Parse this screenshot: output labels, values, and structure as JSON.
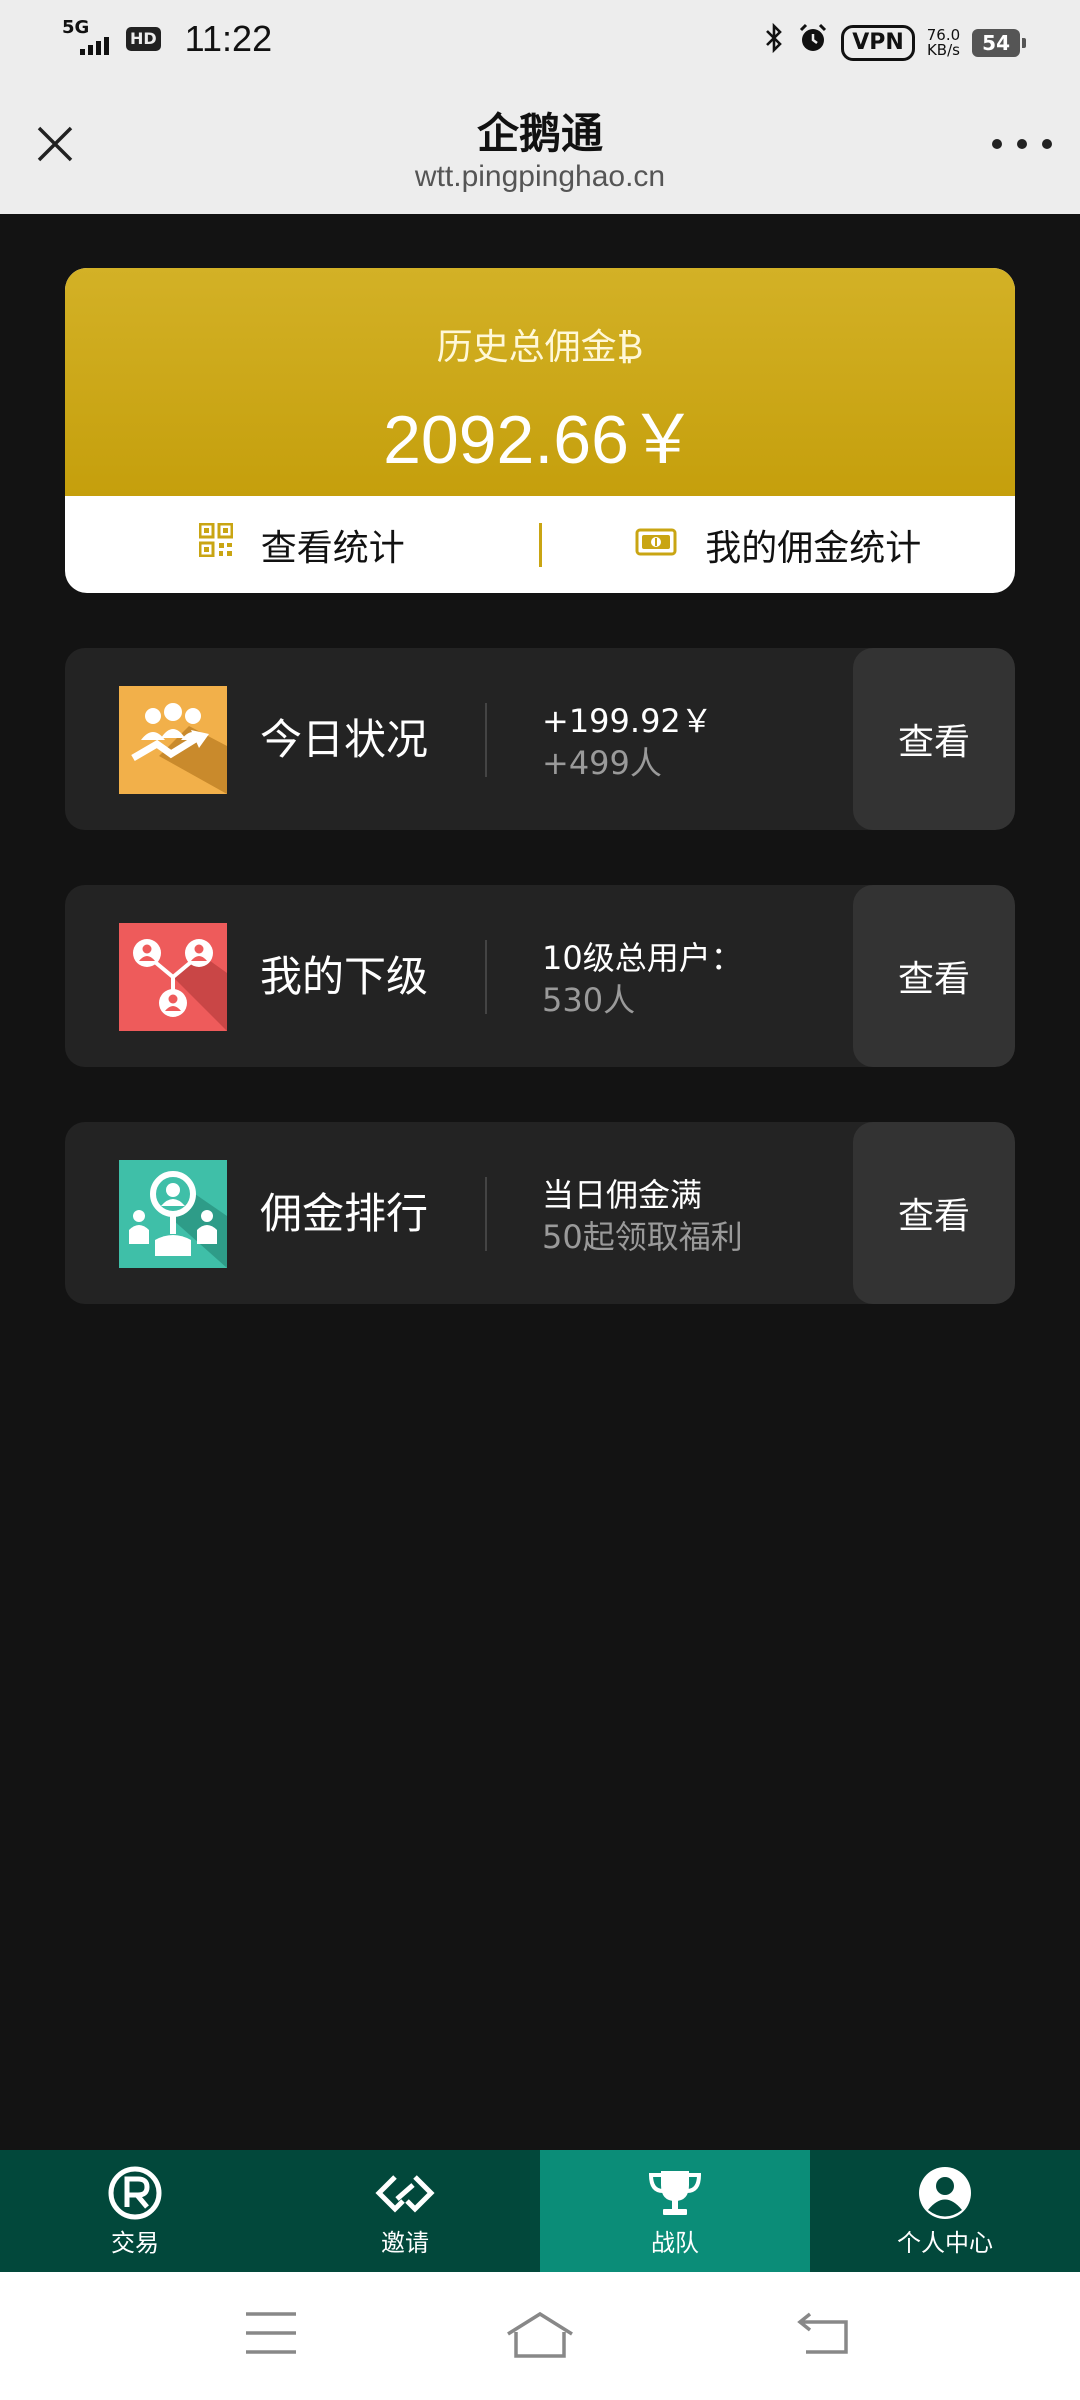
{
  "status_bar": {
    "network": "5G",
    "hd": "HD",
    "time": "11:22",
    "vpn": "VPN",
    "speed_value": "76.0",
    "speed_unit": "KB/s",
    "battery": "54"
  },
  "header": {
    "title": "企鹅通",
    "url": "wtt.pingpinghao.cn"
  },
  "commission_card": {
    "label": "历史总佣金₿",
    "value": "2092.66￥",
    "view_stats_label": "查看统计",
    "my_commission_stats_label": "我的佣金统计",
    "accent": "#c9a513"
  },
  "rows": [
    {
      "title": "今日状况",
      "line1": "+199.92￥",
      "line2": "+499人",
      "action": "查看",
      "icon": "team-growth-icon",
      "icon_color": "#f2b04a"
    },
    {
      "title": "我的下级",
      "line1": "10级总用户：",
      "line2": "530人",
      "action": "查看",
      "icon": "hierarchy-icon",
      "icon_color": "#ee5b5b"
    },
    {
      "title": "佣金排行",
      "line1": "当日佣金满",
      "line2": "50起领取福利",
      "action": "查看",
      "icon": "ranking-icon",
      "icon_color": "#3fbfa8"
    }
  ],
  "bottom_nav": {
    "items": [
      {
        "label": "交易",
        "icon": "registered-icon"
      },
      {
        "label": "邀请",
        "icon": "link-icon"
      },
      {
        "label": "战队",
        "icon": "trophy-icon",
        "active": true
      },
      {
        "label": "个人中心",
        "icon": "user-icon"
      }
    ],
    "bg": "#02483b",
    "active_bg": "#0b8d78"
  }
}
